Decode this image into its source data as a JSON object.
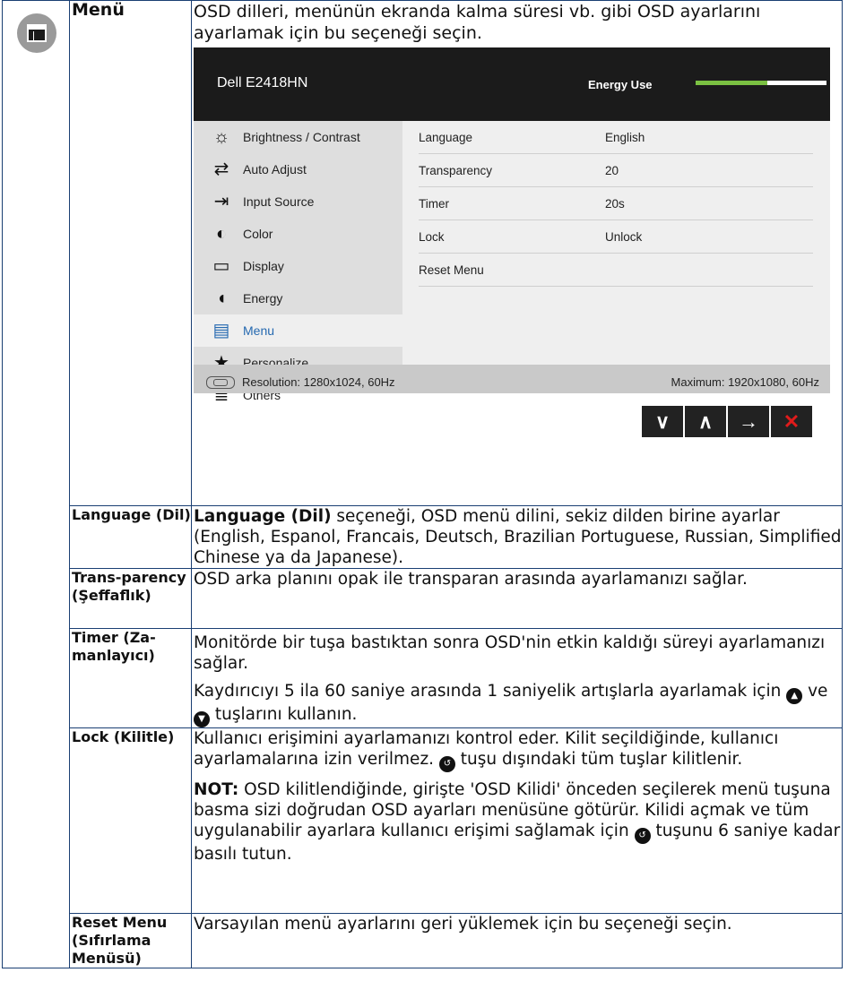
{
  "menu": {
    "title": "Menü",
    "intro": "OSD dilleri, menünün ekranda kalma süresi vb. gibi OSD ayarlarını ayarlamak için bu seçeneği seçin.",
    "icon": "menu-window-icon"
  },
  "osd": {
    "model": "Dell E2418HN",
    "energy_label": "Energy Use",
    "energy_level": 0.55,
    "colors": {
      "energy_fill": "#7bc142",
      "active_item": "#2569b0",
      "close": "#e01b1b"
    },
    "left_items": [
      {
        "label": "Brightness / Contrast",
        "icon": "sun-icon"
      },
      {
        "label": "Auto Adjust",
        "icon": "auto-adjust-icon"
      },
      {
        "label": "Input Source",
        "icon": "input-source-icon"
      },
      {
        "label": "Color",
        "icon": "color-palette-icon"
      },
      {
        "label": "Display",
        "icon": "monitor-icon"
      },
      {
        "label": "Energy",
        "icon": "energy-drop-icon"
      },
      {
        "label": "Menu",
        "icon": "menu-window-icon"
      },
      {
        "label": "Personalize",
        "icon": "star-icon"
      },
      {
        "label": "Others",
        "icon": "sliders-icon"
      }
    ],
    "active_item": "Menu",
    "settings": [
      {
        "key": "Language",
        "value": "English"
      },
      {
        "key": "Transparency",
        "value": "20"
      },
      {
        "key": "Timer",
        "value": "20s"
      },
      {
        "key": "Lock",
        "value": "Unlock"
      },
      {
        "key": "Reset Menu",
        "value": ""
      }
    ],
    "resolution": "Resolution: 1280x1024, 60Hz",
    "maximum": "Maximum: 1920x1080, 60Hz",
    "buttons": [
      "down-arrow-icon",
      "up-arrow-icon",
      "right-arrow-icon",
      "close-icon"
    ]
  },
  "rows": [
    {
      "name": "Language (Dil)",
      "desc_bold": "Language (Dil)",
      "desc": " seçeneği, OSD menü dilini, sekiz dilden birine ayarlar (English, Espanol, Francais, Deutsch, Brazilian Portuguese, Russian, Simplified Chinese ya da Japanese)."
    },
    {
      "name": "Trans-parency (Şeffaflık)",
      "desc": "OSD arka planını opak ile transparan arasında ayarlamanızı sağlar."
    },
    {
      "name": "Timer (Za-manlayıcı)",
      "desc": "Monitörde bir tuşa bastıktan sonra OSD'nin etkin kaldığı süreyi ayarlamanızı sağlar.",
      "desc2_a": "Kaydırıcıyı 5 ila 60 saniye arasında 1 saniyelik artışlarla ayarlamak için ",
      "desc2_b": " ve ",
      "desc2_c": " tuşlarını kullanın."
    },
    {
      "name": "Lock (Kilitle)",
      "desc_a": "Kullanıcı erişimini ayarlamanızı kontrol eder. Kilit seçildiğinde, kullanıcı ayarlamalarına izin verilmez. ",
      "desc_b": " tuşu dışındaki tüm tuşlar kilitlenir.",
      "note_label": "NOT:",
      "note_a": " OSD kilitlendiğinde, girişte 'OSD Kilidi' önceden seçilerek menü tuşuna basma sizi doğrudan OSD ayarları menüsüne götürür. Kilidi açmak ve tüm uygulanabilir ayarlara kullanıcı erişimi sağlamak için ",
      "note_b": " tuşunu 6 saniye kadar basılı tutun."
    },
    {
      "name": "Reset Menu (Sıfırlama Menüsü)",
      "desc": "Varsayılan menü ayarlarını geri yüklemek için bu seçeneği seçin."
    }
  ]
}
